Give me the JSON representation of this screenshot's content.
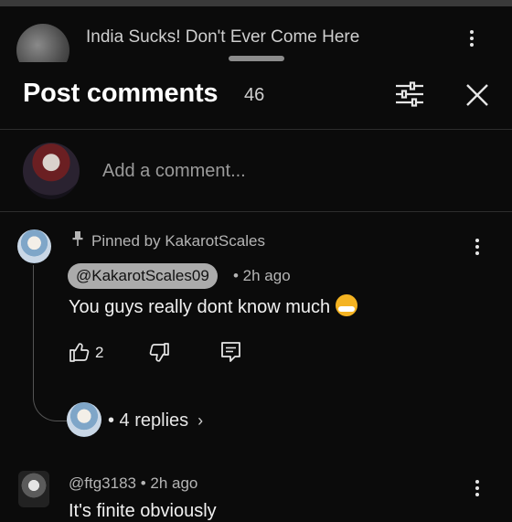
{
  "video": {
    "title": "India Sucks! Don't Ever Come Here"
  },
  "header": {
    "title": "Post comments",
    "count": "46"
  },
  "composer": {
    "placeholder": "Add a comment..."
  },
  "comments": [
    {
      "pinned_label": "Pinned by KakarotScales",
      "author": "@KakarotScales09",
      "time": "• 2h ago",
      "text": "You guys really dont know much",
      "emoji": "sneezing-face",
      "likes": "2",
      "replies_label": "• 4 replies"
    },
    {
      "author": "@ftg3183",
      "time": "• 2h ago",
      "text": "It's finite obviously"
    }
  ],
  "icons": {
    "filter": "sliders-icon",
    "close": "close-icon",
    "pin": "pin-icon",
    "like": "thumbs-up-icon",
    "dislike": "thumbs-down-icon",
    "reply": "comment-icon",
    "more": "more-vertical-icon",
    "chevron": "chevron-right-icon"
  },
  "colors": {
    "background": "#0b0b0b",
    "chip": "#ababab",
    "muted": "#b5b5b5"
  }
}
